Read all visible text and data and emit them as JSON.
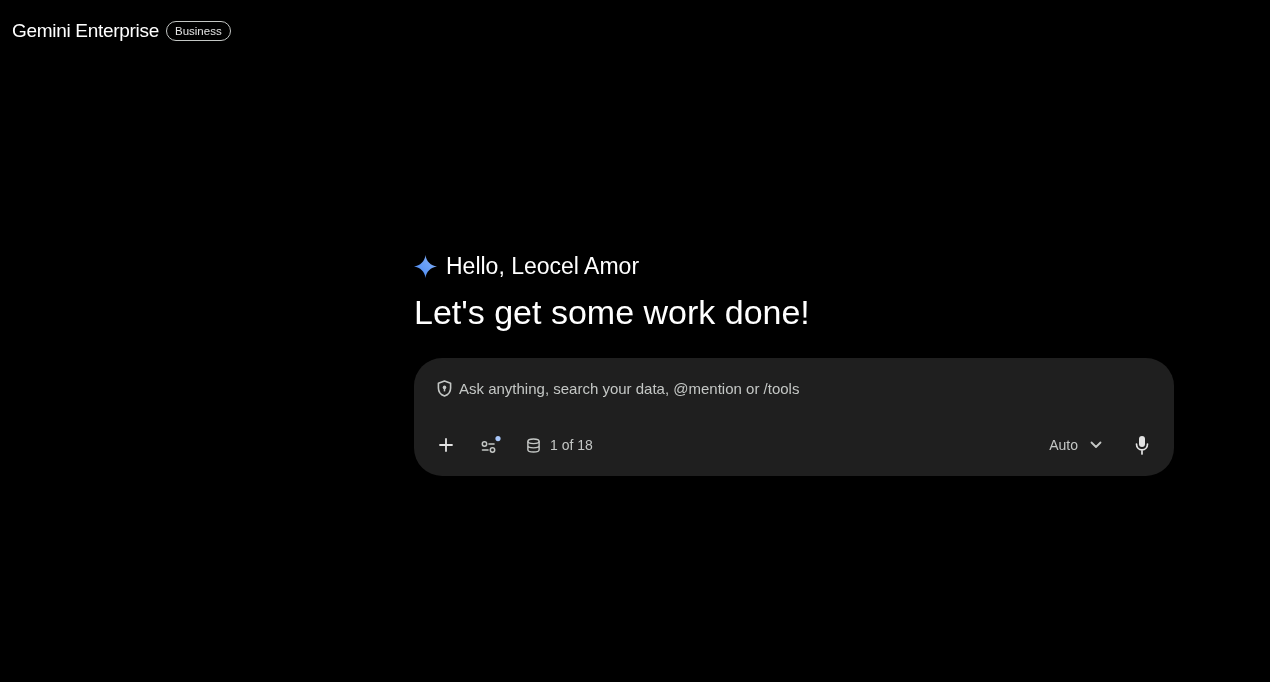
{
  "header": {
    "title": "Gemini Enterprise",
    "badge": "Business"
  },
  "greeting": {
    "line": "Hello, Leocel Amor",
    "headline": "Let's get some work done!"
  },
  "composer": {
    "placeholder": "Ask anything, search your data, @mention or /tools",
    "tools": {
      "indicator": true
    },
    "data_sources": "1 of 18",
    "model": "Auto"
  }
}
